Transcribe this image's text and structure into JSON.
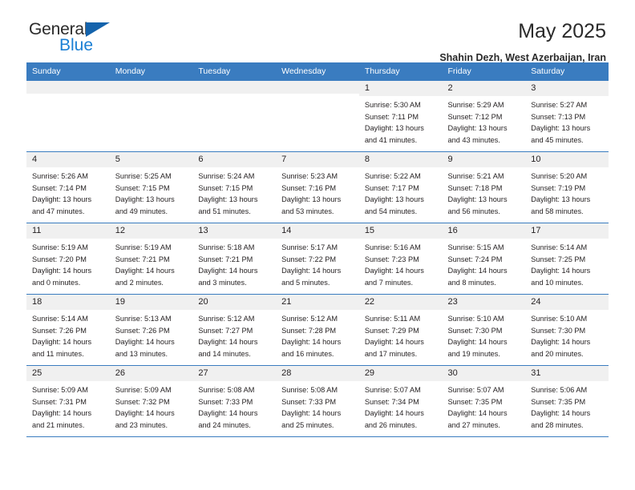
{
  "logo": {
    "word1": "General",
    "word2": "Blue",
    "triangle_color": "#1463ac",
    "blue_color": "#1a7fd4"
  },
  "header": {
    "title": "May 2025",
    "subtitle": "Shahin Dezh, West Azerbaijan, Iran"
  },
  "theme": {
    "header_bg": "#3a7cc0",
    "daynum_bg": "#f0f0f0",
    "text": "#231f20"
  },
  "weekday_headers": [
    "Sunday",
    "Monday",
    "Tuesday",
    "Wednesday",
    "Thursday",
    "Friday",
    "Saturday"
  ],
  "weeks": [
    [
      {
        "day": "",
        "empty": true,
        "sunrise": "",
        "sunset": "",
        "daylight1": "",
        "daylight2": ""
      },
      {
        "day": "",
        "empty": true,
        "sunrise": "",
        "sunset": "",
        "daylight1": "",
        "daylight2": ""
      },
      {
        "day": "",
        "empty": true,
        "sunrise": "",
        "sunset": "",
        "daylight1": "",
        "daylight2": ""
      },
      {
        "day": "",
        "empty": true,
        "sunrise": "",
        "sunset": "",
        "daylight1": "",
        "daylight2": ""
      },
      {
        "day": "1",
        "empty": false,
        "sunrise": "Sunrise: 5:30 AM",
        "sunset": "Sunset: 7:11 PM",
        "daylight1": "Daylight: 13 hours",
        "daylight2": "and 41 minutes."
      },
      {
        "day": "2",
        "empty": false,
        "sunrise": "Sunrise: 5:29 AM",
        "sunset": "Sunset: 7:12 PM",
        "daylight1": "Daylight: 13 hours",
        "daylight2": "and 43 minutes."
      },
      {
        "day": "3",
        "empty": false,
        "sunrise": "Sunrise: 5:27 AM",
        "sunset": "Sunset: 7:13 PM",
        "daylight1": "Daylight: 13 hours",
        "daylight2": "and 45 minutes."
      }
    ],
    [
      {
        "day": "4",
        "empty": false,
        "sunrise": "Sunrise: 5:26 AM",
        "sunset": "Sunset: 7:14 PM",
        "daylight1": "Daylight: 13 hours",
        "daylight2": "and 47 minutes."
      },
      {
        "day": "5",
        "empty": false,
        "sunrise": "Sunrise: 5:25 AM",
        "sunset": "Sunset: 7:15 PM",
        "daylight1": "Daylight: 13 hours",
        "daylight2": "and 49 minutes."
      },
      {
        "day": "6",
        "empty": false,
        "sunrise": "Sunrise: 5:24 AM",
        "sunset": "Sunset: 7:15 PM",
        "daylight1": "Daylight: 13 hours",
        "daylight2": "and 51 minutes."
      },
      {
        "day": "7",
        "empty": false,
        "sunrise": "Sunrise: 5:23 AM",
        "sunset": "Sunset: 7:16 PM",
        "daylight1": "Daylight: 13 hours",
        "daylight2": "and 53 minutes."
      },
      {
        "day": "8",
        "empty": false,
        "sunrise": "Sunrise: 5:22 AM",
        "sunset": "Sunset: 7:17 PM",
        "daylight1": "Daylight: 13 hours",
        "daylight2": "and 54 minutes."
      },
      {
        "day": "9",
        "empty": false,
        "sunrise": "Sunrise: 5:21 AM",
        "sunset": "Sunset: 7:18 PM",
        "daylight1": "Daylight: 13 hours",
        "daylight2": "and 56 minutes."
      },
      {
        "day": "10",
        "empty": false,
        "sunrise": "Sunrise: 5:20 AM",
        "sunset": "Sunset: 7:19 PM",
        "daylight1": "Daylight: 13 hours",
        "daylight2": "and 58 minutes."
      }
    ],
    [
      {
        "day": "11",
        "empty": false,
        "sunrise": "Sunrise: 5:19 AM",
        "sunset": "Sunset: 7:20 PM",
        "daylight1": "Daylight: 14 hours",
        "daylight2": "and 0 minutes."
      },
      {
        "day": "12",
        "empty": false,
        "sunrise": "Sunrise: 5:19 AM",
        "sunset": "Sunset: 7:21 PM",
        "daylight1": "Daylight: 14 hours",
        "daylight2": "and 2 minutes."
      },
      {
        "day": "13",
        "empty": false,
        "sunrise": "Sunrise: 5:18 AM",
        "sunset": "Sunset: 7:21 PM",
        "daylight1": "Daylight: 14 hours",
        "daylight2": "and 3 minutes."
      },
      {
        "day": "14",
        "empty": false,
        "sunrise": "Sunrise: 5:17 AM",
        "sunset": "Sunset: 7:22 PM",
        "daylight1": "Daylight: 14 hours",
        "daylight2": "and 5 minutes."
      },
      {
        "day": "15",
        "empty": false,
        "sunrise": "Sunrise: 5:16 AM",
        "sunset": "Sunset: 7:23 PM",
        "daylight1": "Daylight: 14 hours",
        "daylight2": "and 7 minutes."
      },
      {
        "day": "16",
        "empty": false,
        "sunrise": "Sunrise: 5:15 AM",
        "sunset": "Sunset: 7:24 PM",
        "daylight1": "Daylight: 14 hours",
        "daylight2": "and 8 minutes."
      },
      {
        "day": "17",
        "empty": false,
        "sunrise": "Sunrise: 5:14 AM",
        "sunset": "Sunset: 7:25 PM",
        "daylight1": "Daylight: 14 hours",
        "daylight2": "and 10 minutes."
      }
    ],
    [
      {
        "day": "18",
        "empty": false,
        "sunrise": "Sunrise: 5:14 AM",
        "sunset": "Sunset: 7:26 PM",
        "daylight1": "Daylight: 14 hours",
        "daylight2": "and 11 minutes."
      },
      {
        "day": "19",
        "empty": false,
        "sunrise": "Sunrise: 5:13 AM",
        "sunset": "Sunset: 7:26 PM",
        "daylight1": "Daylight: 14 hours",
        "daylight2": "and 13 minutes."
      },
      {
        "day": "20",
        "empty": false,
        "sunrise": "Sunrise: 5:12 AM",
        "sunset": "Sunset: 7:27 PM",
        "daylight1": "Daylight: 14 hours",
        "daylight2": "and 14 minutes."
      },
      {
        "day": "21",
        "empty": false,
        "sunrise": "Sunrise: 5:12 AM",
        "sunset": "Sunset: 7:28 PM",
        "daylight1": "Daylight: 14 hours",
        "daylight2": "and 16 minutes."
      },
      {
        "day": "22",
        "empty": false,
        "sunrise": "Sunrise: 5:11 AM",
        "sunset": "Sunset: 7:29 PM",
        "daylight1": "Daylight: 14 hours",
        "daylight2": "and 17 minutes."
      },
      {
        "day": "23",
        "empty": false,
        "sunrise": "Sunrise: 5:10 AM",
        "sunset": "Sunset: 7:30 PM",
        "daylight1": "Daylight: 14 hours",
        "daylight2": "and 19 minutes."
      },
      {
        "day": "24",
        "empty": false,
        "sunrise": "Sunrise: 5:10 AM",
        "sunset": "Sunset: 7:30 PM",
        "daylight1": "Daylight: 14 hours",
        "daylight2": "and 20 minutes."
      }
    ],
    [
      {
        "day": "25",
        "empty": false,
        "sunrise": "Sunrise: 5:09 AM",
        "sunset": "Sunset: 7:31 PM",
        "daylight1": "Daylight: 14 hours",
        "daylight2": "and 21 minutes."
      },
      {
        "day": "26",
        "empty": false,
        "sunrise": "Sunrise: 5:09 AM",
        "sunset": "Sunset: 7:32 PM",
        "daylight1": "Daylight: 14 hours",
        "daylight2": "and 23 minutes."
      },
      {
        "day": "27",
        "empty": false,
        "sunrise": "Sunrise: 5:08 AM",
        "sunset": "Sunset: 7:33 PM",
        "daylight1": "Daylight: 14 hours",
        "daylight2": "and 24 minutes."
      },
      {
        "day": "28",
        "empty": false,
        "sunrise": "Sunrise: 5:08 AM",
        "sunset": "Sunset: 7:33 PM",
        "daylight1": "Daylight: 14 hours",
        "daylight2": "and 25 minutes."
      },
      {
        "day": "29",
        "empty": false,
        "sunrise": "Sunrise: 5:07 AM",
        "sunset": "Sunset: 7:34 PM",
        "daylight1": "Daylight: 14 hours",
        "daylight2": "and 26 minutes."
      },
      {
        "day": "30",
        "empty": false,
        "sunrise": "Sunrise: 5:07 AM",
        "sunset": "Sunset: 7:35 PM",
        "daylight1": "Daylight: 14 hours",
        "daylight2": "and 27 minutes."
      },
      {
        "day": "31",
        "empty": false,
        "sunrise": "Sunrise: 5:06 AM",
        "sunset": "Sunset: 7:35 PM",
        "daylight1": "Daylight: 14 hours",
        "daylight2": "and 28 minutes."
      }
    ]
  ]
}
